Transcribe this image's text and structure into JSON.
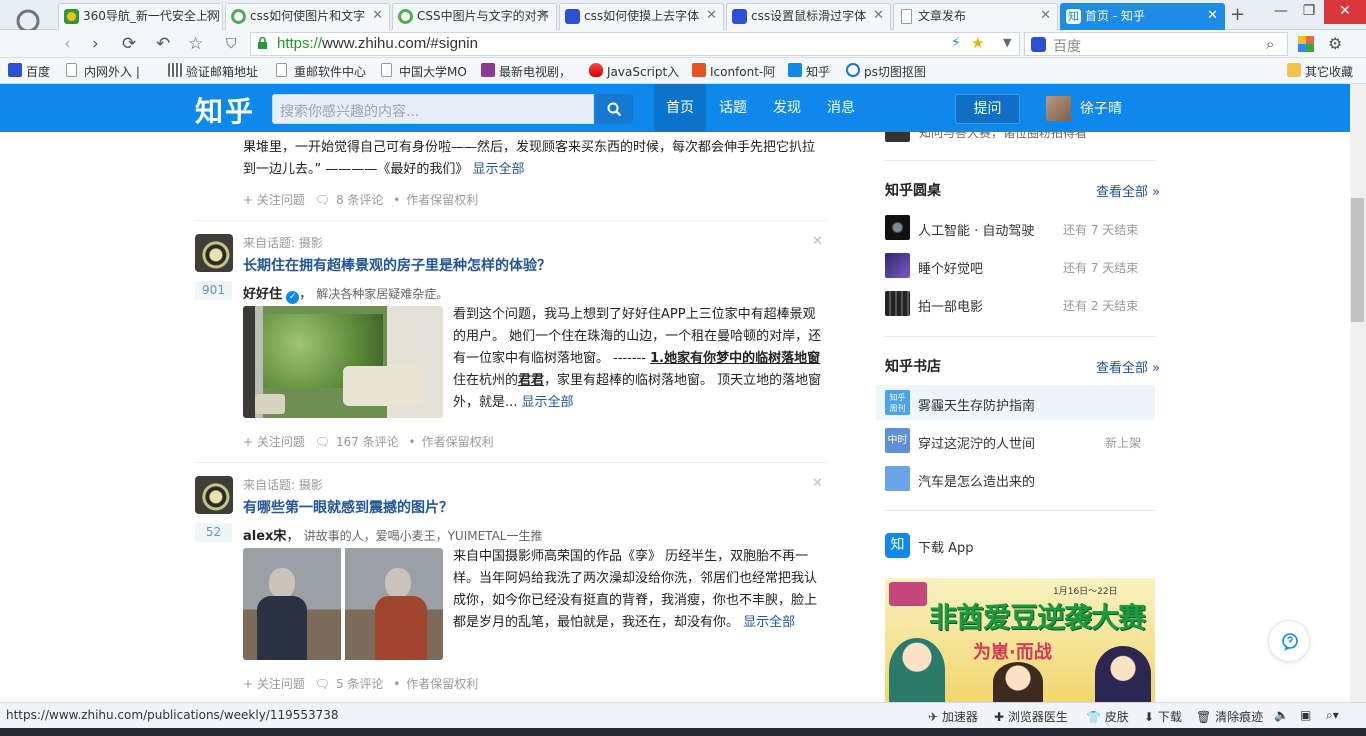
{
  "browser": {
    "tabs": [
      {
        "label": "360导航_新一代安全上网",
        "active": false,
        "icon": "360-icon"
      },
      {
        "label": "css如何使图片和文字",
        "active": false,
        "icon": "green-c-icon"
      },
      {
        "label": "CSS中图片与文字的对齐",
        "active": false,
        "icon": "green-c-icon"
      },
      {
        "label": "css如何使摸上去字体",
        "active": false,
        "icon": "baidu-paw-icon"
      },
      {
        "label": "css设置鼠标滑过字体",
        "active": false,
        "icon": "baidu-paw-icon"
      },
      {
        "label": "文章发布",
        "active": false,
        "icon": "page-icon"
      },
      {
        "label": "首页 - 知乎",
        "active": true,
        "icon": "zhihu-icon"
      }
    ],
    "new_tab": "+",
    "window_buttons": {
      "minimize": "—",
      "restore": "❐",
      "close": "✕"
    },
    "url_scheme": "https://",
    "url_rest": "www.zhihu.com/#signin",
    "search_placeholder": "百度",
    "bookmarks": [
      {
        "label": "百度"
      },
      {
        "label": "内网外入 |"
      },
      {
        "label": "验证邮箱地址"
      },
      {
        "label": "重邮软件中心"
      },
      {
        "label": "中国大学MO"
      },
      {
        "label": "最新电视剧，"
      },
      {
        "label": "JavaScript入"
      },
      {
        "label": "Iconfont-阿"
      },
      {
        "label": "知乎"
      },
      {
        "label": "ps切图抠图"
      }
    ],
    "other_bookmarks": "其它收藏",
    "status_url": "https://www.zhihu.com/publications/weekly/119553738",
    "status_items": [
      "加速器",
      "浏览器医生",
      "皮肤",
      "下载",
      "清除痕迹"
    ]
  },
  "zhihu": {
    "logo": "知乎",
    "search_placeholder": "搜索你感兴趣的内容...",
    "nav": [
      "首页",
      "话题",
      "发现",
      "消息"
    ],
    "ask_button": "提问",
    "user_name": "徐子晴"
  },
  "feed": {
    "item0": {
      "excerpt_line1": "果堆里，一开始觉得自己可有身份啦——然后，发现顾客来买东西的时候，每次都会伸手先把它扒拉",
      "excerpt_line2": "到一边儿去。” ————《最好的我们》",
      "show_all": "显示全部",
      "follow": "+ 关注问题",
      "comments": "8 条评论",
      "rights": "作者保留权利"
    },
    "item1": {
      "topic": "来自话题: 摄影",
      "title": "长期住在拥有超棒景观的房子里是种怎样的体验？",
      "votes": "901",
      "author": "好好住",
      "author_bio": "解决各种家居疑难杂症。",
      "text_line1": "看到这个问题，我马上想到了好好住APP上三位家中有超棒景观",
      "text_line2": "的用户。 她们一个住在珠海的山边，一个租在曼哈顿的对岸，还",
      "text_line3a": "有一位家中有临树落地窗。 ------- ",
      "text_line3b": "1.她家有你梦中的临树落地窗",
      "text_line4a": "住在杭州的",
      "text_line4b": "君君",
      "text_line4c": "，家里有超棒的临树落地窗。 顶天立地的落地窗",
      "text_line5": "外，就是...",
      "show_all": "显示全部",
      "follow": "+ 关注问题",
      "comments": "167 条评论",
      "rights": "作者保留权利"
    },
    "item2": {
      "topic": "来自话题: 摄影",
      "title": "有哪些第一眼就感到震撼的图片？",
      "votes": "52",
      "author": "alex宋",
      "author_bio": "讲故事的人，爱喝小麦王，YUIMETAL一生推",
      "text_line1": "来自中国摄影师高荣国的作品《孪》 历经半生，双胞胎不再一",
      "text_line2": "样。当年阿妈给我洗了两次澡却没给你洗，邻居们也经常把我认",
      "text_line3": "成你，如今你已经没有挺直的背脊，我消瘦，你也不丰腴，脸上",
      "text_line4": "都是岁月的乱笔，最怕就是，我还在，却没有你。",
      "show_all": "显示全部",
      "follow": "+ 关注问题",
      "comments": "5 条评论",
      "rights": "作者保留权利"
    }
  },
  "sidebar": {
    "top_partial": "知问与答大赛，诸位圈粉拍得看",
    "roundtable_title": "知乎圆桌",
    "roundtable_more": "查看全部 »",
    "roundtables": [
      {
        "name": "人工智能 · 自动驾驶",
        "status": "还有 7 天结束"
      },
      {
        "name": "睡个好觉吧",
        "status": "还有 7 天结束"
      },
      {
        "name": "拍一部电影",
        "status": "还有 2 天结束"
      }
    ],
    "books_title": "知乎书店",
    "books_more": "查看全部 »",
    "books": [
      {
        "name": "雾霾天生存防护指南",
        "badge": "知乎\n周刊",
        "status": ""
      },
      {
        "name": "穿过这泥泞的人世间",
        "badge": "中时",
        "status": "新上架"
      },
      {
        "name": "汽车是怎么造出来的",
        "badge": "",
        "status": ""
      }
    ],
    "download_app": "下载 App",
    "download_icon_label": "知",
    "banner_date": "1月16日～22日",
    "banner_title": "非酋爱豆逆袭大赛",
    "banner_sub": "为崽·而战"
  }
}
